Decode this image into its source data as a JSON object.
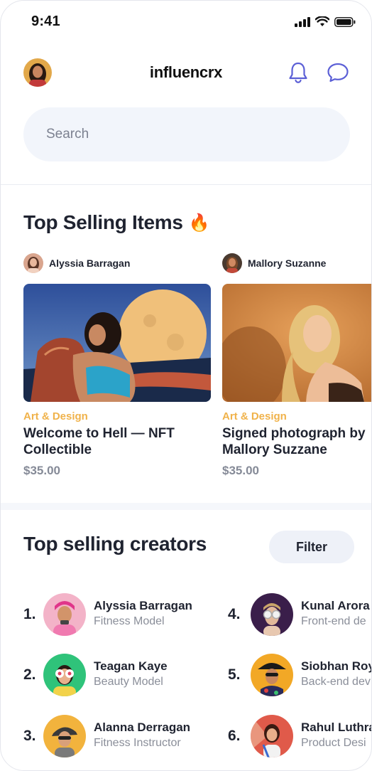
{
  "status_bar": {
    "time": "9:41"
  },
  "header": {
    "brand": "influencrx",
    "icons": [
      "bell-icon",
      "chat-icon"
    ]
  },
  "search": {
    "placeholder": "Search"
  },
  "top_items": {
    "title": "Top Selling Items",
    "title_emoji": "🔥",
    "items": [
      {
        "seller": "Alyssia Barragan",
        "category": "Art & Design",
        "name": "Welcome to Hell — NFT Collectible",
        "price": "$35.00"
      },
      {
        "seller": "Mallory Suzanne",
        "category": "Art & Design",
        "name": "Signed photograph by Mallory Suzzane",
        "price": "$35.00"
      }
    ]
  },
  "creators": {
    "title": "Top selling creators",
    "filter_label": "Filter",
    "list": [
      {
        "rank": "1.",
        "name": "Alyssia Barragan",
        "role": "Fitness Model"
      },
      {
        "rank": "2.",
        "name": "Teagan Kaye",
        "role": "Beauty Model"
      },
      {
        "rank": "3.",
        "name": "Alanna Derragan",
        "role": "Fitness Instructor"
      },
      {
        "rank": "4.",
        "name": "Kunal Arora",
        "role": "Front-end de"
      },
      {
        "rank": "5.",
        "name": "Siobhan Roy",
        "role": "Back-end dev"
      },
      {
        "rank": "6.",
        "name": "Rahul Luthra",
        "role": "Product Desi"
      }
    ]
  },
  "colors": {
    "accent": "#5b5fd6",
    "category": "#f0b24a",
    "muted": "#8a8e99"
  }
}
